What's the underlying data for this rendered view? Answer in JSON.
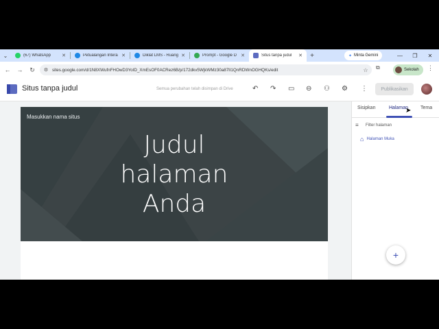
{
  "browser": {
    "tabs": [
      {
        "title": "(67) WhatsApp",
        "favicon_color": "#25d366"
      },
      {
        "title": "Petualangan Intera",
        "favicon_color": "#1e88e5"
      },
      {
        "title": "Diklat LMS - Ruang",
        "favicon_color": "#1e88e5"
      },
      {
        "title": "Prompt - Google D",
        "favicon_color": "#34a853"
      },
      {
        "title": "Situs tanpa judul",
        "favicon_color": "#5c6bc0",
        "active": true
      }
    ],
    "gemini_label": "Minta Gemini",
    "url": "sites.google.com/d/1N8XWufnFHOwD3YoID_XmEsOF0ACRez6B/p/172dkv5WjkWMz30a87lI1QnRDWnOGHQKs/edit",
    "profile_label": "Sekolah"
  },
  "app": {
    "title": "Situs tanpa judul",
    "save_status": "Semua perubahan telah disimpan di Drive",
    "publish_label": "Publikasikan"
  },
  "canvas": {
    "site_name_placeholder": "Masukkan nama situs",
    "hero_title": "Judul halaman Anda"
  },
  "panel": {
    "tabs": [
      "Sisipkan",
      "Halaman",
      "Tema"
    ],
    "active_tab": "Halaman",
    "filter_placeholder": "Filter halaman",
    "pages": [
      "Halaman Muka"
    ]
  },
  "colors": {
    "accent": "#3f51b5",
    "hero_bg": "#3c4446",
    "tabstrip_bg": "#d3e3fd"
  },
  "icons": [
    "chevron-down-icon",
    "close-icon",
    "plus-icon",
    "back-icon",
    "forward-icon",
    "reload-icon",
    "tune-icon",
    "star-icon",
    "extensions-icon",
    "kebab-icon",
    "undo-icon",
    "redo-icon",
    "preview-icon",
    "link-icon",
    "add-person-icon",
    "gear-icon",
    "filter-icon",
    "home-icon",
    "pointer-icon"
  ]
}
